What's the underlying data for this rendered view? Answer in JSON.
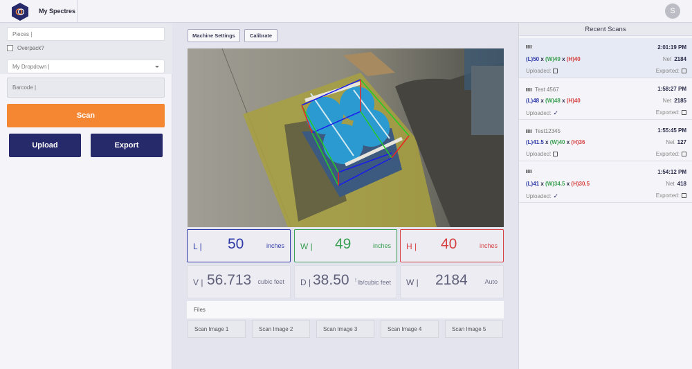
{
  "app": {
    "title": "My Spectres",
    "avatar_initial": "S",
    "brand_color": "#26296a",
    "accent_color": "#f58632"
  },
  "left": {
    "pieces_placeholder": "Pieces |",
    "overpack_label": "Overpack?",
    "overpack_checked": false,
    "dropdown_value": "My Dropdown |",
    "barcode_placeholder": "Barcode |",
    "scan_label": "Scan",
    "upload_label": "Upload",
    "export_label": "Export"
  },
  "toolbar": {
    "machine_settings_label": "Machine Settings",
    "calibrate_label": "Calibrate"
  },
  "photo": {
    "description": "pallet of four blue drums with bounding box overlay",
    "box_colors": {
      "length": "#1a1aee",
      "width": "#22cc22",
      "height": "#ee2222"
    }
  },
  "metrics": {
    "length": {
      "label": "L |",
      "value": "50",
      "unit": "inches",
      "color": "#2e3aa8"
    },
    "width": {
      "label": "W |",
      "value": "49",
      "unit": "inches",
      "color": "#3aa052"
    },
    "height": {
      "label": "H |",
      "value": "40",
      "unit": "inches",
      "color": "#d64040"
    },
    "volume": {
      "label": "V |",
      "value": "56.713",
      "unit": "cubic feet"
    },
    "density": {
      "label": "D |",
      "value": "38.50",
      "unit": "lb/cubic feet",
      "marker": "!"
    },
    "weight": {
      "label": "W |",
      "value": "2184",
      "unit": "Auto"
    }
  },
  "files": {
    "title": "Files",
    "items": [
      "Scan Image 1",
      "Scan Image 2",
      "Scan Image 3",
      "Scan Image 4",
      "Scan Image 5"
    ]
  },
  "recent": {
    "title": "Recent Scans",
    "net_label": "Net",
    "uploaded_label": "Uploaded:",
    "exported_label": "Exported:",
    "x_sep": "x",
    "items": [
      {
        "barcode": "",
        "time": "2:01:19 PM",
        "l": "(L)50",
        "w": "(W)49",
        "h": "(H)40",
        "net": "2184",
        "uploaded": false,
        "exported": false,
        "active": true
      },
      {
        "barcode": "Test 4567",
        "time": "1:58:27 PM",
        "l": "(L)48",
        "w": "(W)48",
        "h": "(H)40",
        "net": "2185",
        "uploaded": true,
        "exported": false,
        "active": false
      },
      {
        "barcode": "Test12345",
        "time": "1:55:45 PM",
        "l": "(L)41.5",
        "w": "(W)40",
        "h": "(H)36",
        "net": "127",
        "uploaded": false,
        "exported": false,
        "active": false
      },
      {
        "barcode": "",
        "time": "1:54:12 PM",
        "l": "(L)41",
        "w": "(W)34.5",
        "h": "(H)30.5",
        "net": "418",
        "uploaded": true,
        "exported": false,
        "active": false
      }
    ]
  }
}
